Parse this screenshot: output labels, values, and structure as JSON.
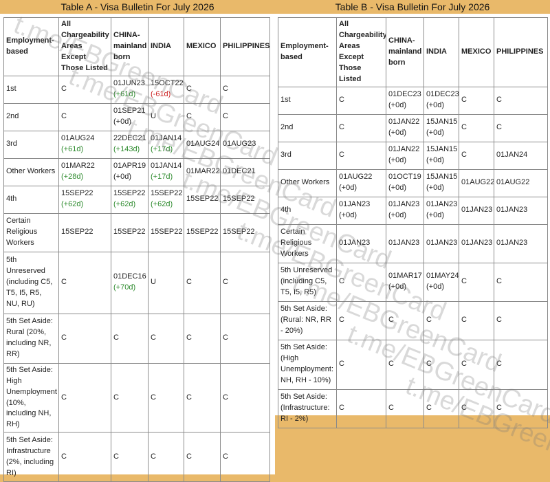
{
  "watermark": "t.me/EBGreenCard",
  "tableA": {
    "title": "Table A - Visa Bulletin For July 2026",
    "headers": [
      "Employment-based",
      "All Chargeability Areas Except Those Listed",
      "CHINA-mainland born",
      "INDIA",
      "MEXICO",
      "PHILIPPINES"
    ],
    "rows": [
      {
        "label": "1st",
        "h": 40,
        "cells": [
          {
            "v": "C"
          },
          {
            "v": "01JUN23",
            "c": "(+61d)",
            "s": "pos"
          },
          {
            "v": "15OCT22",
            "c": "(-61d)",
            "s": "neg"
          },
          {
            "v": "C"
          },
          {
            "v": "C"
          }
        ]
      },
      {
        "label": "2nd",
        "h": 40,
        "cells": [
          {
            "v": "C"
          },
          {
            "v": "01SEP21",
            "c": "(+0d)",
            "s": "zero"
          },
          {
            "v": "U"
          },
          {
            "v": "C"
          },
          {
            "v": "C"
          }
        ]
      },
      {
        "label": "3rd",
        "h": 40,
        "cells": [
          {
            "v": "01AUG24",
            "c": "(+61d)",
            "s": "pos"
          },
          {
            "v": "22DEC21",
            "c": "(+143d)",
            "s": "pos"
          },
          {
            "v": "01JAN14",
            "c": "(+17d)",
            "s": "pos"
          },
          {
            "v": "01AUG24"
          },
          {
            "v": "01AUG23"
          }
        ]
      },
      {
        "label": "Other Workers",
        "h": 40,
        "cells": [
          {
            "v": "01MAR22",
            "c": "(+28d)",
            "s": "pos"
          },
          {
            "v": "01APR19",
            "c": "(+0d)",
            "s": "zero"
          },
          {
            "v": "01JAN14",
            "c": "(+17d)",
            "s": "pos"
          },
          {
            "v": "01MAR22"
          },
          {
            "v": "01DEC21"
          }
        ]
      },
      {
        "label": "4th",
        "h": 40,
        "cells": [
          {
            "v": "15SEP22",
            "c": "(+62d)",
            "s": "pos"
          },
          {
            "v": "15SEP22",
            "c": "(+62d)",
            "s": "pos"
          },
          {
            "v": "15SEP22",
            "c": "(+62d)",
            "s": "pos"
          },
          {
            "v": "15SEP22"
          },
          {
            "v": "15SEP22"
          }
        ]
      },
      {
        "label": "Certain Religious Workers",
        "h": 56,
        "cells": [
          {
            "v": "15SEP22"
          },
          {
            "v": "15SEP22"
          },
          {
            "v": "15SEP22"
          },
          {
            "v": "15SEP22"
          },
          {
            "v": "15SEP22"
          }
        ]
      },
      {
        "label": "5th Unreserved (including C5, T5, I5, R5, NU, RU)",
        "h": 90,
        "cells": [
          {
            "v": "C"
          },
          {
            "v": "01DEC16",
            "c": "(+70d)",
            "s": "pos"
          },
          {
            "v": "U"
          },
          {
            "v": "C"
          },
          {
            "v": "C"
          }
        ]
      },
      {
        "label": "5th Set Aside: Rural (20%, including NR, RR)",
        "h": 72,
        "cells": [
          {
            "v": "C"
          },
          {
            "v": "C"
          },
          {
            "v": "C"
          },
          {
            "v": "C"
          },
          {
            "v": "C"
          }
        ]
      },
      {
        "label": "5th Set Aside: High Unemployment (10%, including NH, RH)",
        "h": 90,
        "cells": [
          {
            "v": "C"
          },
          {
            "v": "C"
          },
          {
            "v": "C"
          },
          {
            "v": "C"
          },
          {
            "v": "C"
          }
        ]
      },
      {
        "label": "5th Set Aside: Infrastructure (2%, including RI)",
        "h": 72,
        "cells": [
          {
            "v": "C"
          },
          {
            "v": "C"
          },
          {
            "v": "C"
          },
          {
            "v": "C"
          },
          {
            "v": "C"
          }
        ]
      }
    ]
  },
  "tableB": {
    "title": "Table B - Visa Bulletin For July 2026",
    "headers": [
      "Employment-based",
      "All Chargeability Areas Except Those Listed",
      "CHINA-mainland born",
      "INDIA",
      "MEXICO",
      "PHILIPPINES"
    ],
    "rows": [
      {
        "label": "1st",
        "h": 40,
        "cells": [
          {
            "v": "C"
          },
          {
            "v": "01DEC23",
            "c": "(+0d)",
            "s": "zero"
          },
          {
            "v": "01DEC23",
            "c": "(+0d)",
            "s": "zero"
          },
          {
            "v": "C"
          },
          {
            "v": "C"
          }
        ]
      },
      {
        "label": "2nd",
        "h": 40,
        "cells": [
          {
            "v": "C"
          },
          {
            "v": "01JAN22",
            "c": "(+0d)",
            "s": "zero"
          },
          {
            "v": "15JAN15",
            "c": "(+0d)",
            "s": "zero"
          },
          {
            "v": "C"
          },
          {
            "v": "C"
          }
        ]
      },
      {
        "label": "3rd",
        "h": 40,
        "cells": [
          {
            "v": "C"
          },
          {
            "v": "01JAN22",
            "c": "(+0d)",
            "s": "zero"
          },
          {
            "v": "15JAN15",
            "c": "(+0d)",
            "s": "zero"
          },
          {
            "v": "C"
          },
          {
            "v": "01JAN24"
          }
        ]
      },
      {
        "label": "Other Workers",
        "h": 40,
        "cells": [
          {
            "v": "01AUG22",
            "c": "(+0d)",
            "s": "zero"
          },
          {
            "v": "01OCT19",
            "c": "(+0d)",
            "s": "zero"
          },
          {
            "v": "15JAN15",
            "c": "(+0d)",
            "s": "zero"
          },
          {
            "v": "01AUG22"
          },
          {
            "v": "01AUG22"
          }
        ]
      },
      {
        "label": "4th",
        "h": 40,
        "cells": [
          {
            "v": "01JAN23",
            "c": "(+0d)",
            "s": "zero"
          },
          {
            "v": "01JAN23",
            "c": "(+0d)",
            "s": "zero"
          },
          {
            "v": "01JAN23",
            "c": "(+0d)",
            "s": "zero"
          },
          {
            "v": "01JAN23"
          },
          {
            "v": "01JAN23"
          }
        ]
      },
      {
        "label": "Certain Religious Workers",
        "h": 56,
        "cells": [
          {
            "v": "01JAN23"
          },
          {
            "v": "01JAN23"
          },
          {
            "v": "01JAN23"
          },
          {
            "v": "01JAN23"
          },
          {
            "v": "01JAN23"
          }
        ]
      },
      {
        "label": "5th Unreserved (including C5, T5, I5, R5)",
        "h": 56,
        "cells": [
          {
            "v": "C"
          },
          {
            "v": "01MAR17",
            "c": "(+0d)",
            "s": "zero"
          },
          {
            "v": "01MAY24",
            "c": "(+0d)",
            "s": "zero"
          },
          {
            "v": "C"
          },
          {
            "v": "C"
          }
        ]
      },
      {
        "label": "5th Set Aside: (Rural: NR, RR - 20%)",
        "h": 56,
        "cells": [
          {
            "v": "C"
          },
          {
            "v": "C"
          },
          {
            "v": "C"
          },
          {
            "v": "C"
          },
          {
            "v": "C"
          }
        ]
      },
      {
        "label": "5th Set Aside: (High Unemployment: NH, RH - 10%)",
        "h": 72,
        "cells": [
          {
            "v": "C"
          },
          {
            "v": "C"
          },
          {
            "v": "C"
          },
          {
            "v": "C"
          },
          {
            "v": "C"
          }
        ]
      },
      {
        "label": "5th Set Aside: (Infrastructure: RI - 2%)",
        "h": 56,
        "cells": [
          {
            "v": "C"
          },
          {
            "v": "C"
          },
          {
            "v": "C"
          },
          {
            "v": "C"
          },
          {
            "v": "C"
          }
        ]
      }
    ]
  }
}
